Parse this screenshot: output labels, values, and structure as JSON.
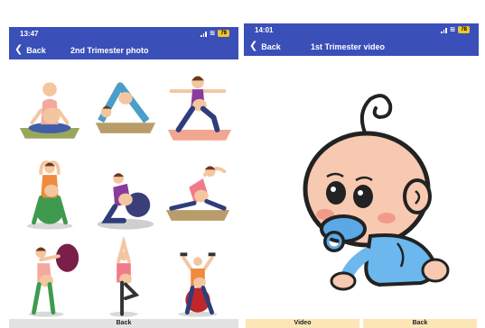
{
  "left_screen": {
    "status_time": "13:47",
    "battery": "79",
    "back_label": "Back",
    "title": "2nd Trimester photo",
    "bottom_button_label": "Back"
  },
  "right_screen": {
    "status_time": "14:01",
    "battery": "78",
    "back_label": "Back",
    "title": "1st Trimester video",
    "video_button_label": "Video",
    "back_button_label": "Back"
  },
  "colors": {
    "appbar": "#3a4fb8",
    "battery": "#f0c52c",
    "bottom_buttons": "#fde6b5"
  },
  "icons": [
    "back-arrow-icon",
    "wifi-icon",
    "signal-icon",
    "battery-icon"
  ]
}
